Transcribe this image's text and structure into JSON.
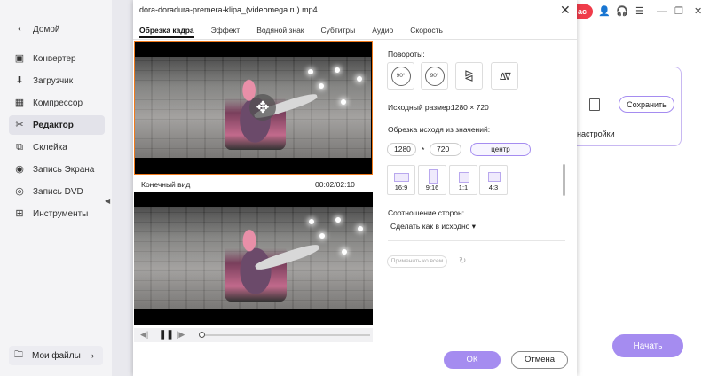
{
  "sidebar": {
    "home": "Домой",
    "items": [
      {
        "label": "Конвертер",
        "icon": "converter-icon",
        "glyph": "▣"
      },
      {
        "label": "Загрузчик",
        "icon": "download-icon",
        "glyph": "⬇"
      },
      {
        "label": "Компрессор",
        "icon": "compress-icon",
        "glyph": "▦"
      },
      {
        "label": "Редактор",
        "icon": "scissors-icon",
        "glyph": "✂"
      },
      {
        "label": "Склейка",
        "icon": "merge-icon",
        "glyph": "⧉"
      },
      {
        "label": "Запись Экрана",
        "icon": "screen-record-icon",
        "glyph": "◉"
      },
      {
        "label": "Запись DVD",
        "icon": "disc-icon",
        "glyph": "◎"
      },
      {
        "label": "Инструменты",
        "icon": "toolbox-icon",
        "glyph": "⊞"
      }
    ],
    "active_index": 3,
    "my_files": "Мои файлы"
  },
  "background_app": {
    "badge": "ас",
    "save_label": "Сохранить",
    "settings_label": "настройки",
    "start_label": "Начать"
  },
  "dialog": {
    "title": "dora-doradura-premera-klipa_(videomega.ru).mp4",
    "tabs": [
      "Обрезка кадра",
      "Эффект",
      "Водяной знак",
      "Субтитры",
      "Аудио",
      "Скорость"
    ],
    "active_tab": 0,
    "final_view_label": "Конечный вид",
    "time": "00:02/02:10",
    "rotation_label": "Повороты:",
    "rotate_cw": "90°",
    "rotate_ccw": "90°",
    "source_size_label": "Исходный размер:",
    "source_size_value": "1280 × 720",
    "crop_label": "Обрезка исходя из значений:",
    "crop_width": "1280",
    "crop_sep": "*",
    "crop_height": "720",
    "center_button": "центр",
    "ratios": [
      "16:9",
      "9:16",
      "1:1",
      "4:3"
    ],
    "aspect_label": "Соотношение сторон:",
    "aspect_value": "Сделать как в исходно",
    "apply_all": "Применить ко всем",
    "ok": "ОК",
    "cancel": "Отмена"
  },
  "colors": {
    "accent": "#a58cf0",
    "crop_border": "#f07a1c",
    "badge": "#f03c4a"
  }
}
